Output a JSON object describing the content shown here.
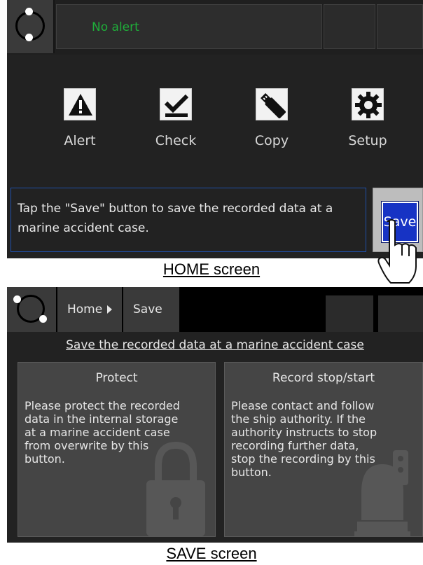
{
  "home": {
    "alert_text": "No alert",
    "apps": [
      {
        "label": "Alert",
        "icon": "warning-triangle-icon"
      },
      {
        "label": "Check",
        "icon": "checkmark-icon"
      },
      {
        "label": "Copy",
        "icon": "usb-stick-icon"
      },
      {
        "label": "Setup",
        "icon": "gear-icon"
      }
    ],
    "message": "Tap the \"Save\" button to save the recorded data at a marine accident case.",
    "save_label": "Save"
  },
  "captions": {
    "home": "HOME screen",
    "save": "SAVE screen"
  },
  "save_screen": {
    "breadcrumb": [
      {
        "label": "Home"
      },
      {
        "label": "Save"
      }
    ],
    "heading": "Save the recorded data at a marine accident case",
    "panels": [
      {
        "title": "Protect",
        "body": "Please protect the recorded\ndata in the internal storage\nat a marine accident case\nfrom overwrite by this\nbutton.",
        "icon": "padlock-icon"
      },
      {
        "title": "Record stop/start",
        "body": "Please contact and follow\nthe ship authority. If the\nauthority instructs to stop\nrecording further data,\nstop the recording by this\nbutton.",
        "icon": "recorder-icon"
      }
    ]
  },
  "colors": {
    "alert_green": "#1fae3a",
    "save_blue": "#1733c4",
    "message_border": "#1f4fa8"
  }
}
